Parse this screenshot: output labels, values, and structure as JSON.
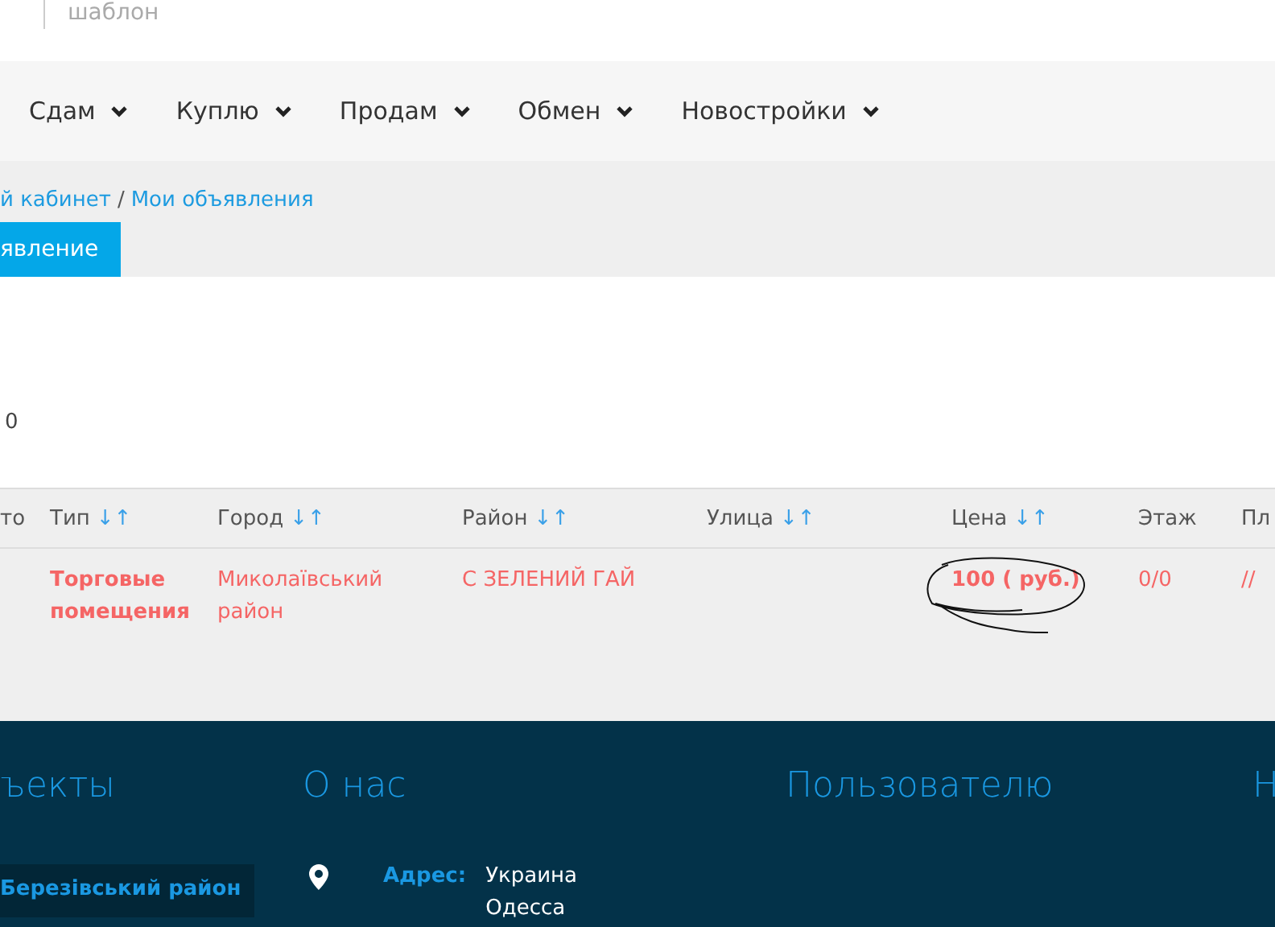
{
  "header": {
    "subtitle": "шаблон"
  },
  "nav": [
    {
      "label": "Сдам"
    },
    {
      "label": "Куплю"
    },
    {
      "label": "Продам"
    },
    {
      "label": "Обмен"
    },
    {
      "label": "Новостройки"
    }
  ],
  "breadcrumb": [
    {
      "label": "й кабинет"
    },
    {
      "label": "Мои объявления"
    }
  ],
  "breadcrumb_separator": "/",
  "add_button": "явление",
  "count": "0",
  "table": {
    "columns": [
      {
        "label": "то"
      },
      {
        "label": "Тип",
        "sort_arrows": "↓↑"
      },
      {
        "label": "Город",
        "sort_arrows": "↓↑"
      },
      {
        "label": "Район",
        "sort_arrows": "↓↑"
      },
      {
        "label": "Улица",
        "sort_arrows": "↓↑"
      },
      {
        "label": "Цена",
        "sort_arrows": "↓↑"
      },
      {
        "label": "Этаж"
      },
      {
        "label": "Пл"
      }
    ],
    "rows": [
      {
        "cells": [
          "",
          "Торговые помещения",
          "Миколаївський район",
          "С ЗЕЛЕНИЙ ГАЙ",
          "",
          "100 ( руб.)",
          "0/0",
          "//"
        ],
        "bold": [
          false,
          true,
          false,
          false,
          false,
          true,
          false,
          false
        ]
      }
    ]
  },
  "footer": {
    "headings": [
      "ъекты",
      "О нас",
      "Пользователю",
      "Н"
    ],
    "district": "Березівський район",
    "address_label": "Адрес:",
    "address_lines": [
      "Украина",
      "Одесса"
    ]
  }
}
